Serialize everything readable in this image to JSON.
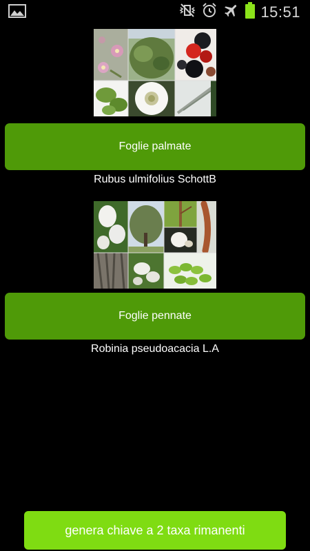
{
  "status_bar": {
    "time": "15:51",
    "icons": [
      "image-icon",
      "vibrate-mute-icon",
      "alarm-icon",
      "airplane-mode-icon",
      "battery-icon"
    ]
  },
  "options": [
    {
      "button_label": "Foglie palmate",
      "taxon": "Rubus ulmifolius SchottB",
      "images": [
        "flower-pink-photo",
        "shrub-photo",
        "blackberry-fruit-photo",
        "leaf-photo",
        "white-flower-photo",
        "stem-thorn-photo"
      ]
    },
    {
      "button_label": "Foglie pennate",
      "taxon": "Robinia pseudoacacia L.A",
      "images": [
        "white-flower-cluster-photo",
        "tree-photo",
        "twig-photo",
        "seed-pod-photo",
        "bark-photo",
        "flower-raceme-photo",
        "compound-leaf-photo"
      ]
    }
  ],
  "footer": {
    "generate_label": "genera chiave a 2 taxa rimanenti"
  },
  "colors": {
    "background": "#000000",
    "choice_button": "#4f9a08",
    "generate_button": "#7fdc12"
  }
}
